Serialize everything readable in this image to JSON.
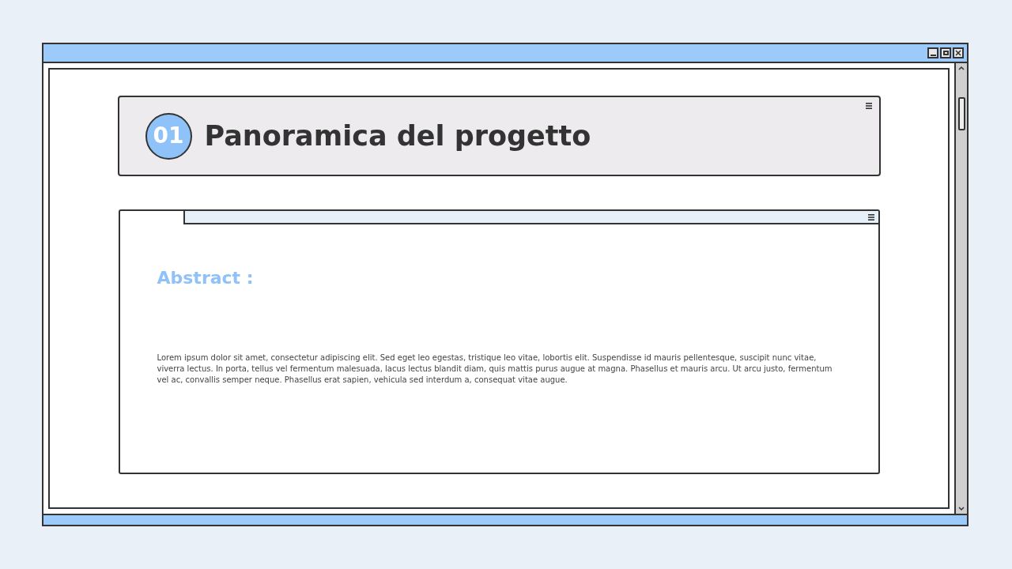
{
  "section": {
    "number": "01",
    "title": "Panoramica del progetto"
  },
  "panel": {
    "heading": "Abstract :",
    "body": "Lorem ipsum dolor sit amet, consectetur adipiscing elit. Sed eget leo egestas, tristique leo vitae, lobortis elit. Suspendisse id mauris pellentesque, suscipit nunc vitae, viverra lectus. In porta, tellus vel fermentum malesuada, lacus lectus blandit diam, quis mattis purus augue at magna. Phasellus et mauris arcu. Ut arcu justo, fermentum vel ac, convallis semper neque. Phasellus erat sapien, vehicula sed interdum a, consequat vitae augue."
  }
}
